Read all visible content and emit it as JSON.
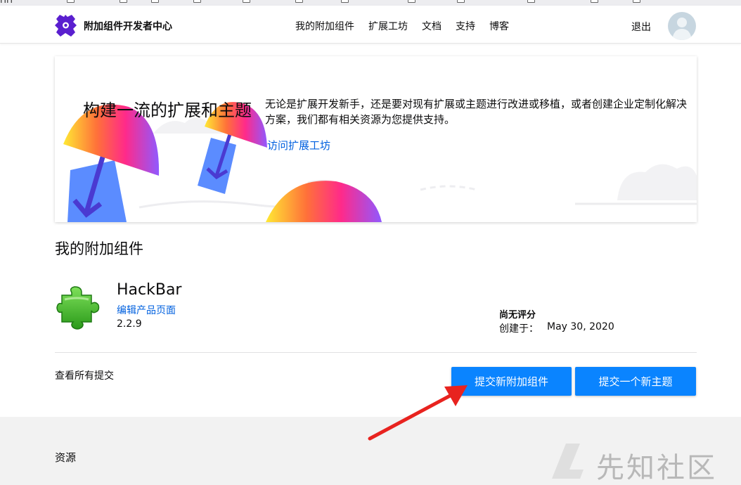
{
  "header": {
    "site_title": "附加组件开发者中心",
    "nav": [
      "我的附加组件",
      "扩展工坊",
      "文档",
      "支持",
      "博客"
    ],
    "logout": "退出"
  },
  "hero": {
    "title": "构建一流的扩展和主题",
    "description": "无论是扩展开发新手，还是要对现有扩展或主题进行改进或移植，或者创建企业定制化解决方案，我们都有相关资源为您提供支持。",
    "link": "访问扩展工坊"
  },
  "my_addons": {
    "title": "我的附加组件",
    "addon": {
      "name": "HackBar",
      "edit_link": "编辑产品页面",
      "version": "2.2.9",
      "rating": "尚无评分",
      "created_label": "创建于：",
      "created_date": "May 30, 2020"
    },
    "view_all": "查看所有提交",
    "submit_addon": "提交新附加组件",
    "submit_theme": "提交一个新主题"
  },
  "footer": {
    "resources": "资源",
    "watermark": "先知社区"
  },
  "colors": {
    "accent": "#0a84ff",
    "link": "#0060df",
    "annotation_arrow": "#e8231f"
  }
}
